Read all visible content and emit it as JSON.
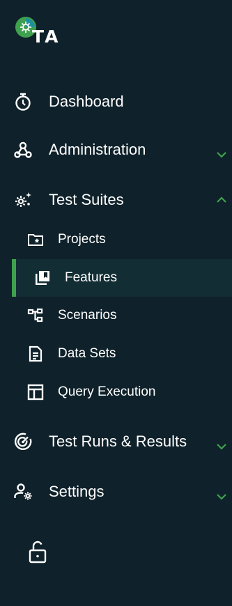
{
  "logo": {
    "text": "TA",
    "icon": "gear-icon"
  },
  "nav": {
    "dashboard": {
      "label": "Dashboard",
      "icon": "stopwatch-icon"
    },
    "administration": {
      "label": "Administration",
      "icon": "webhook-icon",
      "expanded": false
    },
    "test_suites": {
      "label": "Test Suites",
      "icon": "gears-sparkle-icon",
      "expanded": true,
      "items": [
        {
          "label": "Projects",
          "icon": "folder-star-icon"
        },
        {
          "label": "Features",
          "icon": "library-icon",
          "active": true
        },
        {
          "label": "Scenarios",
          "icon": "account-tree-icon"
        },
        {
          "label": "Data Sets",
          "icon": "document-icon"
        },
        {
          "label": "Query Execution",
          "icon": "table-icon"
        }
      ]
    },
    "test_runs": {
      "label": "Test Runs & Results",
      "icon": "target-icon",
      "expanded": false
    },
    "settings": {
      "label": "Settings",
      "icon": "user-gear-icon",
      "expanded": false
    }
  },
  "footer": {
    "icon": "unlock-icon"
  },
  "colors": {
    "background": "#0f212a",
    "active_bg": "#132d34",
    "accent": "#3fa14e",
    "text": "#ffffff"
  }
}
